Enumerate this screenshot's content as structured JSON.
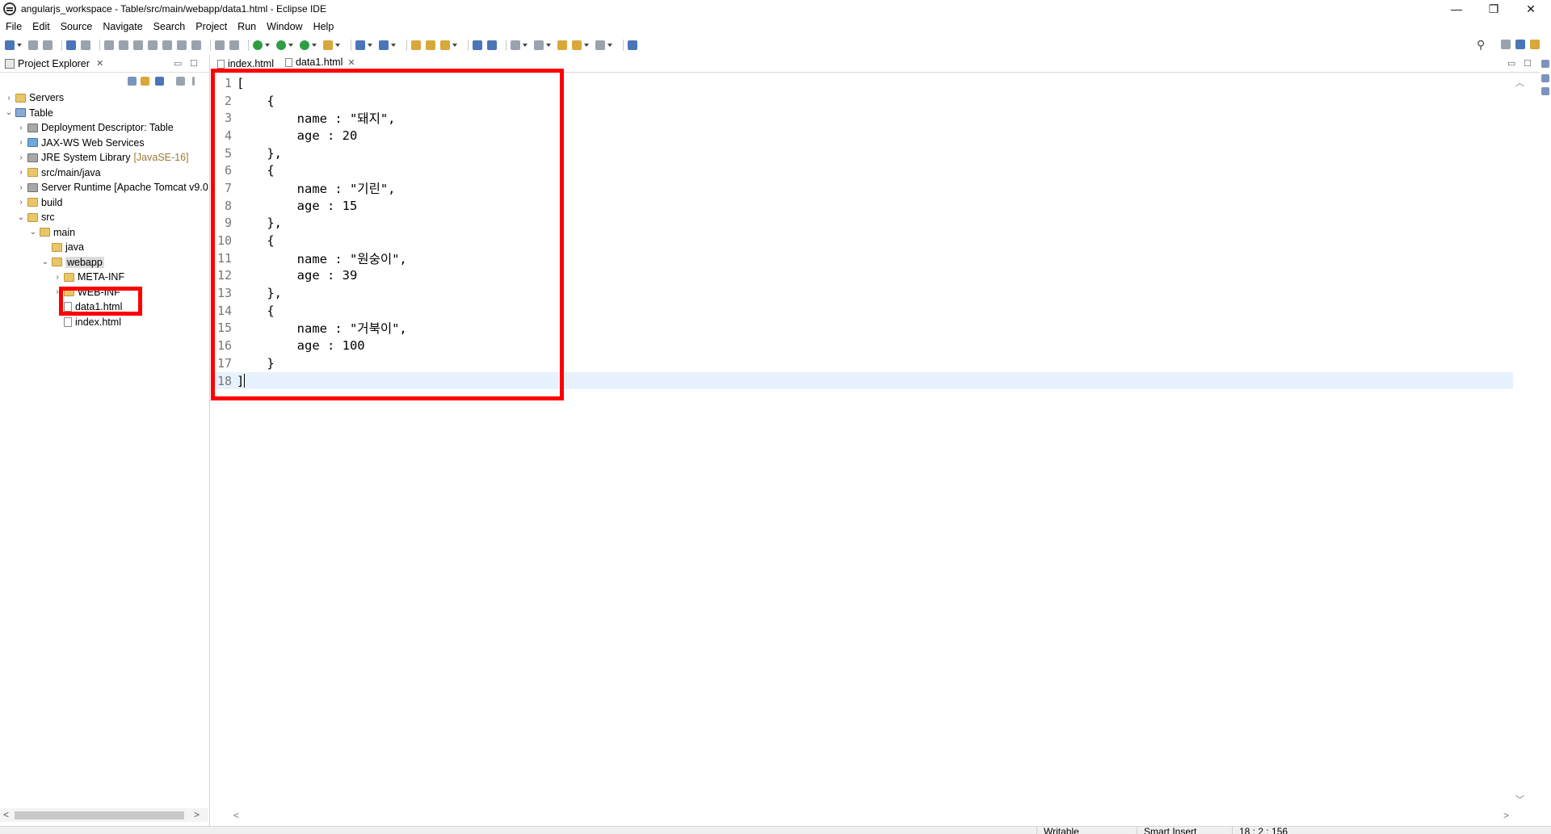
{
  "window": {
    "title": "angularjs_workspace - Table/src/main/webapp/data1.html - Eclipse IDE",
    "minimize": "—",
    "restore": "❐",
    "close": "✕"
  },
  "menu": [
    "File",
    "Edit",
    "Source",
    "Navigate",
    "Search",
    "Project",
    "Run",
    "Window",
    "Help"
  ],
  "project_explorer": {
    "tab_label": "Project Explorer",
    "tree": [
      {
        "label": "Servers",
        "depth": 0,
        "twisty": ">",
        "icon": "folder"
      },
      {
        "label": "Table",
        "depth": 0,
        "twisty": "v",
        "icon": "project"
      },
      {
        "label": "Deployment Descriptor: Table",
        "depth": 1,
        "twisty": ">",
        "icon": "lib"
      },
      {
        "label": "JAX-WS Web Services",
        "depth": 1,
        "twisty": ">",
        "icon": "server"
      },
      {
        "label": "JRE System Library",
        "suffix": "[JavaSE-16]",
        "depth": 1,
        "twisty": ">",
        "icon": "lib"
      },
      {
        "label": "src/main/java",
        "depth": 1,
        "twisty": ">",
        "icon": "folder"
      },
      {
        "label": "Server Runtime [Apache Tomcat v9.0",
        "depth": 1,
        "twisty": ">",
        "icon": "lib"
      },
      {
        "label": "build",
        "depth": 1,
        "twisty": ">",
        "icon": "folder"
      },
      {
        "label": "src",
        "depth": 1,
        "twisty": "v",
        "icon": "folder"
      },
      {
        "label": "main",
        "depth": 2,
        "twisty": "v",
        "icon": "folder"
      },
      {
        "label": "java",
        "depth": 3,
        "twisty": "",
        "icon": "folder"
      },
      {
        "label": "webapp",
        "depth": 3,
        "twisty": "v",
        "icon": "folder",
        "selected": true
      },
      {
        "label": "META-INF",
        "depth": 4,
        "twisty": ">",
        "icon": "folder"
      },
      {
        "label": "WEB-INF",
        "depth": 4,
        "twisty": ">",
        "icon": "folder"
      },
      {
        "label": "data1.html",
        "depth": 4,
        "twisty": "",
        "icon": "file",
        "highlighted": true
      },
      {
        "label": "index.html",
        "depth": 4,
        "twisty": "",
        "icon": "file"
      }
    ]
  },
  "editor": {
    "tabs": [
      {
        "label": "index.html",
        "active": false
      },
      {
        "label": "data1.html",
        "active": true
      }
    ],
    "lines": [
      "[",
      "    {",
      "        name : \"돼지\",",
      "        age : 20",
      "    },",
      "    {",
      "        name : \"기린\",",
      "        age : 15",
      "    },",
      "    {",
      "        name : \"원숭이\",",
      "        age : 39",
      "    },",
      "    {",
      "        name : \"거북이\",",
      "        age : 100",
      "    }",
      "]"
    ],
    "current_line": 18
  },
  "statusbar": {
    "mode": "Writable",
    "insert": "Smart Insert",
    "position": "18 : 2 : 156"
  },
  "colors": {
    "highlight_box": "#ff0000",
    "current_line_bg": "#e8f2fe",
    "selection_bg": "#dcdcdc",
    "line_number": "#787878"
  }
}
